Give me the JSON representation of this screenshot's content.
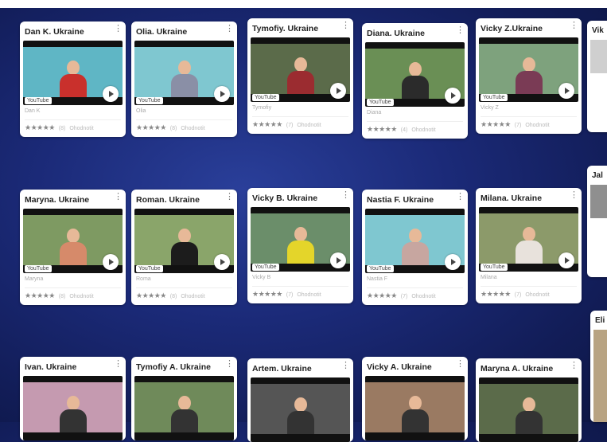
{
  "rows": [
    [
      {
        "title": "Dan K. Ukraine",
        "sub": "Dan K",
        "rating": "8",
        "scene": "#5fb6c5",
        "shirt": "#c9302c"
      },
      {
        "title": "Olia. Ukraine",
        "sub": "Olia",
        "rating": "8",
        "scene": "#7fc7d0",
        "shirt": "#8a8fa6"
      },
      {
        "title": "Tymofiy. Ukraine",
        "sub": "Tymofiy",
        "rating": "7",
        "scene": "#5b6b4a",
        "shirt": "#9b2c30"
      },
      {
        "title": "Diana. Ukraine",
        "sub": "Diana",
        "rating": "4",
        "scene": "#6a8f55",
        "shirt": "#2b2b2b"
      },
      {
        "title": "Vicky Z.Ukraine",
        "sub": "Vicky Z",
        "rating": "7",
        "scene": "#7ea27d",
        "shirt": "#7a3b55"
      }
    ],
    [
      {
        "title": "Maryna. Ukraine",
        "sub": "Maryna",
        "rating": "8",
        "scene": "#7e9a62",
        "shirt": "#d68a6a"
      },
      {
        "title": "Roman. Ukraine",
        "sub": "Roma",
        "rating": "8",
        "scene": "#8aa56a",
        "shirt": "#1c1c1c"
      },
      {
        "title": "Vicky B. Ukraine",
        "sub": "Vicky B",
        "rating": "7",
        "scene": "#6b8e6a",
        "shirt": "#e4d52a"
      },
      {
        "title": "Nastia F. Ukraine",
        "sub": "Nastia F",
        "rating": "7",
        "scene": "#7fc7d0",
        "shirt": "#c7a6a0"
      },
      {
        "title": "Milana. Ukraine",
        "sub": "Milana",
        "rating": "7",
        "scene": "#8c9a6a",
        "shirt": "#e8e2dc"
      }
    ],
    [
      {
        "title": "Ivan. Ukraine",
        "scene": "#c59ab0",
        "shirt": "#333"
      },
      {
        "title": "Tymofiy A. Ukraine",
        "scene": "#6f8a5a",
        "shirt": "#333"
      },
      {
        "title": "Artem. Ukraine",
        "scene": "#555",
        "shirt": "#333"
      },
      {
        "title": "Vicky A. Ukraine",
        "scene": "#9a7a62",
        "shirt": "#333"
      },
      {
        "title": "Maryna A. Ukraine",
        "scene": "#5b6b4a",
        "shirt": "#333"
      }
    ]
  ],
  "common": {
    "yt_label": "YouTube",
    "stars": "★★★★★",
    "rate_label": "Ohodnotit"
  },
  "edge": [
    "Vik",
    "Jal",
    "Eli"
  ]
}
